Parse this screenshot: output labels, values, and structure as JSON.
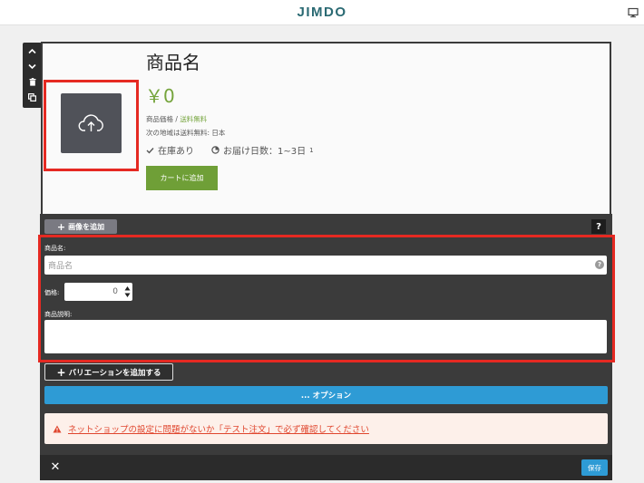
{
  "header": {
    "logo": "JIMDO",
    "device_icon": "monitor-icon"
  },
  "sidetools": {
    "icons": [
      "chevron-up-icon",
      "chevron-down-icon",
      "trash-icon",
      "copy-icon"
    ]
  },
  "product": {
    "title": "商品名",
    "price": "￥0",
    "price_label": "商品価格 /",
    "shipping_free": "送料無料",
    "ship_note": "次の地域は送料無料: 日本",
    "stock": "在庫あり",
    "delivery": "お届け日数：1~3日",
    "delivery_sup": "1",
    "cart_button": "カートに追加",
    "upload_icon": "cloud-upload-icon"
  },
  "editor": {
    "add_image": "画像を追加",
    "help": "?",
    "name_label": "商品名:",
    "name_placeholder": "商品名",
    "input_help": "?",
    "price_label": "価格:",
    "price_value": "0",
    "desc_label": "商品説明:",
    "variation_button": "バリエーションを追加する",
    "options": "... オプション",
    "warning": "ネットショップの設定に問題がないか「テスト注文」で必ず確認してください",
    "close": "✕",
    "save": "保存"
  },
  "colors": {
    "brand": "#2b6a73",
    "accent_green": "#75a43c",
    "accent_blue": "#2e9bd5",
    "highlight_red": "#e52922",
    "warning_red": "#e0462e"
  }
}
